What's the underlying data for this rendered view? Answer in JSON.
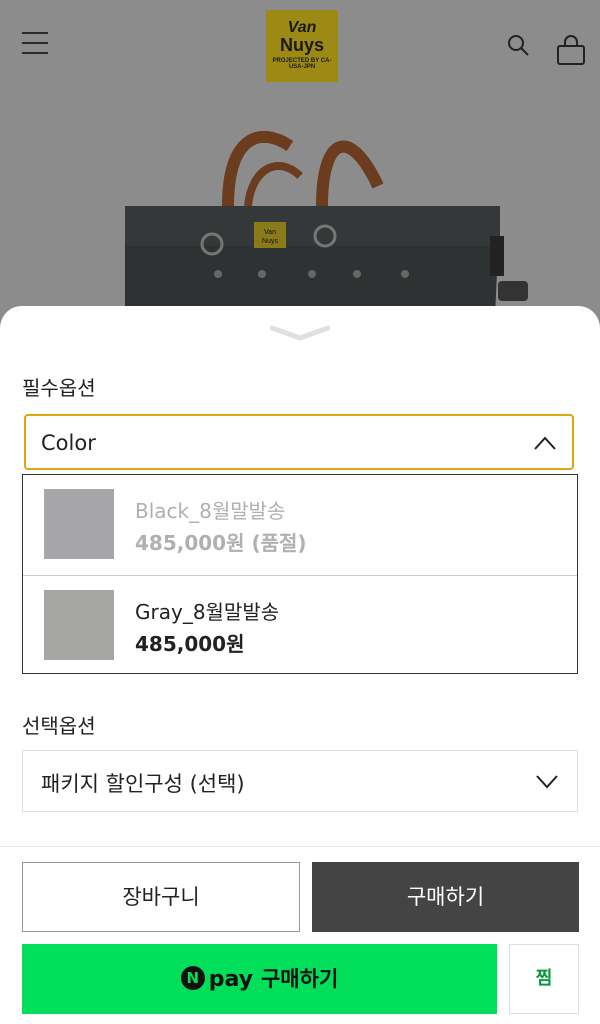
{
  "header": {
    "logo_line1": "Van",
    "logo_line2": "Nuys",
    "logo_tagline": "PROJECTED BY CA-USA-JPN"
  },
  "product_image": {
    "bag_label_line1": "Van",
    "bag_label_line2": "Nuys"
  },
  "options": {
    "required_label": "필수옵션",
    "color_select_value": "Color",
    "color_options": [
      {
        "name": "Black_8월말발송",
        "price": "485,000원 (품절)",
        "swatch": "#a6a5a8",
        "sold_out": true
      },
      {
        "name": "Gray_8월말발송",
        "price": "485,000원",
        "swatch": "#a5a6a4",
        "sold_out": false
      }
    ],
    "optional_label": "선택옵션",
    "package_select_value": "패키지 할인구성 (선택)"
  },
  "actions": {
    "cart_label": "장바구니",
    "buy_label": "구매하기",
    "npay_badge": "N",
    "npay_pay": "pay",
    "npay_label": "구매하기",
    "wish_label": "찜"
  },
  "colors": {
    "accent_border": "#e0a60e",
    "npay_green": "#00de5a",
    "buy_dark": "#444444"
  }
}
